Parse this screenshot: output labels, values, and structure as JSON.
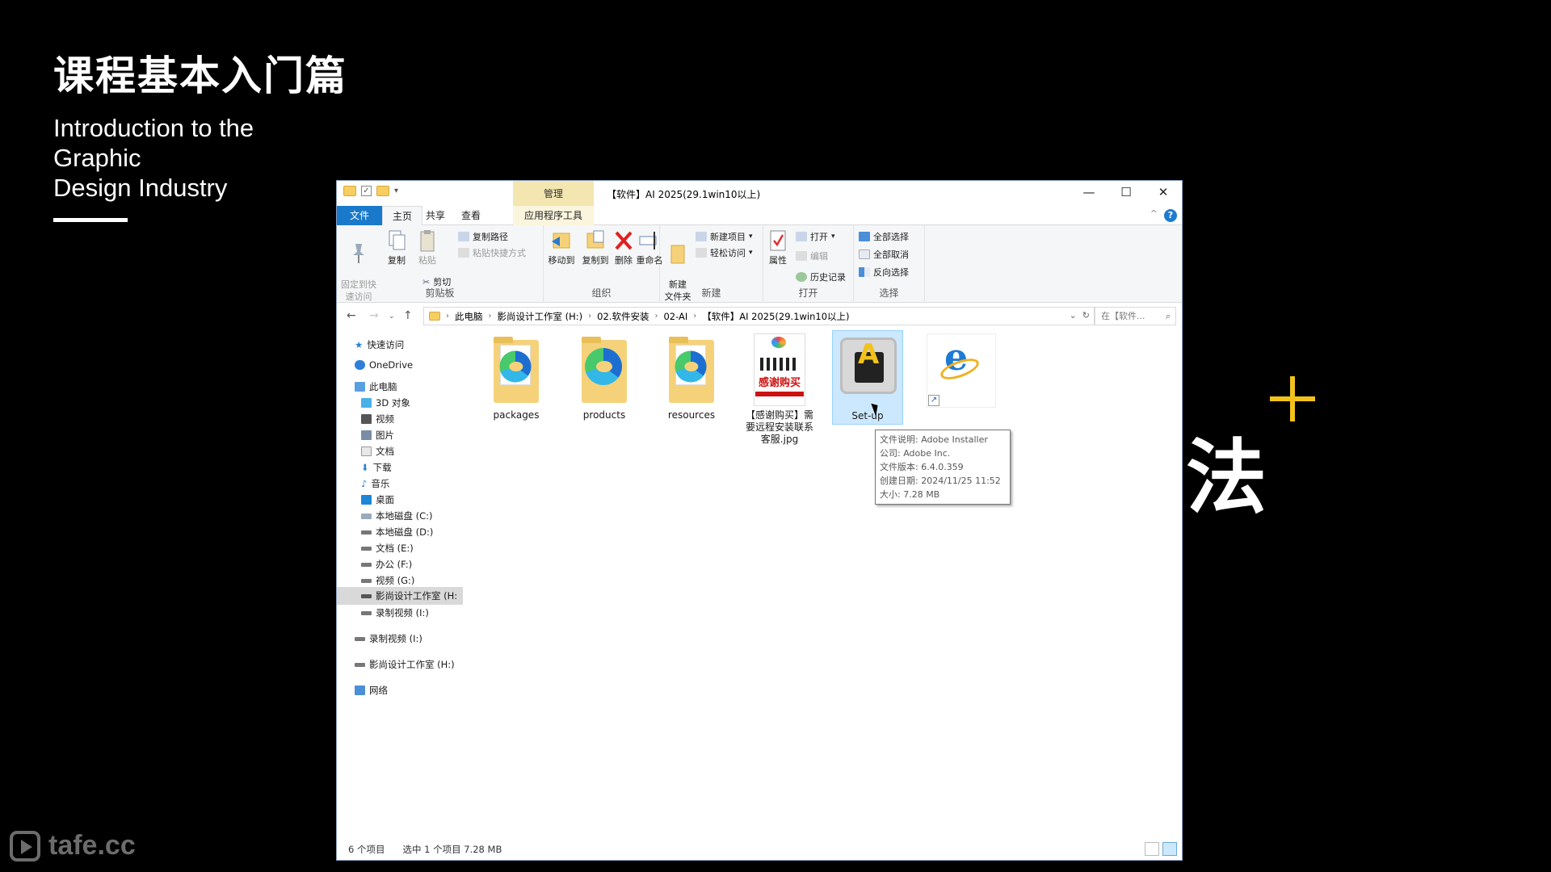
{
  "slide": {
    "title": "课程基本入门篇",
    "subtitle_lines": [
      "Introduction to the",
      "Graphic",
      "Design Industry"
    ],
    "big_char": "法",
    "accent_color": "#f2c21b",
    "watermark": "tafe.cc"
  },
  "window": {
    "title": "【软件】AI 2025(29.1win10以上)",
    "context_tab": "管理",
    "controls": {
      "minimize": "—",
      "maximize": "☐",
      "close": "✕"
    },
    "tabs": {
      "file": "文件",
      "home": "主页",
      "share": "共享",
      "view": "查看",
      "app_tools": "应用程序工具"
    },
    "help": "?"
  },
  "ribbon": {
    "clipboard": {
      "label": "剪贴板",
      "pin": "固定到快\n速访问",
      "copy": "复制",
      "paste": "粘贴",
      "copy_path": "复制路径",
      "paste_shortcut": "粘贴快捷方式",
      "cut": "剪切"
    },
    "organize": {
      "label": "组织",
      "move_to": "移动到",
      "copy_to": "复制到",
      "delete": "删除",
      "rename": "重命名"
    },
    "new": {
      "label": "新建",
      "new_folder": "新建\n文件夹",
      "new_item": "新建项目",
      "easy_access": "轻松访问"
    },
    "open": {
      "label": "打开",
      "properties": "属性",
      "open": "打开",
      "edit": "编辑",
      "history": "历史记录"
    },
    "select": {
      "label": "选择",
      "select_all": "全部选择",
      "select_none": "全部取消",
      "invert": "反向选择"
    }
  },
  "address": {
    "crumbs": [
      "此电脑",
      "影尚设计工作室 (H:)",
      "02.软件安装",
      "02-AI",
      "【软件】AI 2025(29.1win10以上)"
    ],
    "search_placeholder": "在【软件..."
  },
  "nav": {
    "quick_access": "快速访问",
    "onedrive": "OneDrive",
    "this_pc": "此电脑",
    "items": [
      "3D 对象",
      "视频",
      "图片",
      "文档",
      "下载",
      "音乐",
      "桌面",
      "本地磁盘 (C:)",
      "本地磁盘 (D:)",
      "文档 (E:)",
      "办公 (F:)",
      "视频 (G:)",
      "影尚设计工作室 (H:",
      "录制视频 (I:)"
    ],
    "drive_i": "录制视频 (I:)",
    "drive_h": "影尚设计工作室 (H:)",
    "network": "网络"
  },
  "files": [
    {
      "name": "packages",
      "kind": "folder"
    },
    {
      "name": "products",
      "kind": "folder"
    },
    {
      "name": "resources",
      "kind": "folder"
    },
    {
      "name": "【感谢购买】需要远程安装联系客服.jpg",
      "kind": "image",
      "thumb_text": "感谢购买"
    },
    {
      "name": "Set-up",
      "kind": "installer",
      "selected": true
    },
    {
      "name": "",
      "kind": "ie-shortcut"
    }
  ],
  "tooltip": {
    "lines": [
      "文件说明: Adobe Installer",
      "公司: Adobe Inc.",
      "文件版本: 6.4.0.359",
      "创建日期: 2024/11/25 11:52",
      "大小: 7.28 MB"
    ]
  },
  "status": {
    "count": "6 个项目",
    "selection": "选中 1 个项目  7.28 MB"
  }
}
